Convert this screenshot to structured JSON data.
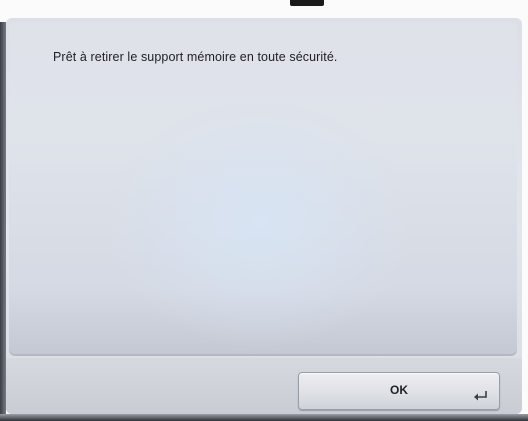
{
  "dialog": {
    "message": "Prêt à retirer le support mémoire en toute sécurité.",
    "ok_label": "OK",
    "enter_icon": "enter-return-icon"
  },
  "colors": {
    "panel": "#dfe2e9",
    "button_bar": "#d6d9e0",
    "button": "#e3e5ea",
    "text": "#1d1f24"
  }
}
